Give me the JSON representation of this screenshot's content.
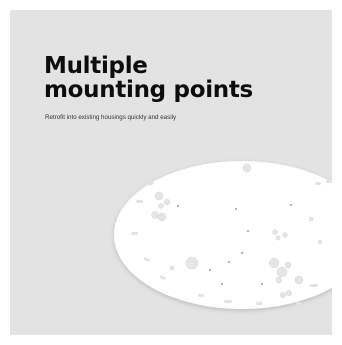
{
  "headline": {
    "line1": "Multiple",
    "line2": "mounting points"
  },
  "subheadline": "Retrofit into existing housings quickly and easily",
  "colors": {
    "background": "#ffffff",
    "panel": "#e3e3e3",
    "plate": "#ffffff",
    "heading": "#0d0d0d"
  }
}
